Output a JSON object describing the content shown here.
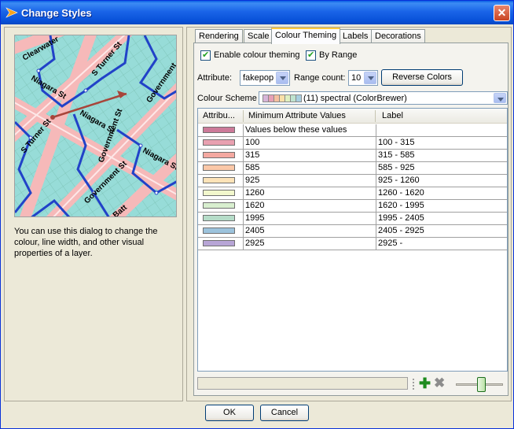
{
  "window": {
    "title": "Change Styles",
    "close_glyph": "✕"
  },
  "map_preview": {
    "streets": [
      "Clearwater",
      "Niagara St",
      "S Turner St",
      "Government",
      "Niagara St",
      "S Turner St",
      "Government St",
      "Niagara St",
      "Government St",
      "Batt"
    ]
  },
  "help_text": "You can use this dialog to change the colour, line width, and other visual properties of a layer.",
  "tabs": [
    {
      "label": "Rendering",
      "active": false
    },
    {
      "label": "Scale",
      "active": false
    },
    {
      "label": "Colour Theming",
      "active": true
    },
    {
      "label": "Labels",
      "active": false
    },
    {
      "label": "Decorations",
      "active": false
    }
  ],
  "theming": {
    "enable_label": "Enable colour theming",
    "enable_checked": true,
    "by_range_label": "By Range",
    "by_range_checked": true,
    "attribute_label": "Attribute:",
    "attribute_value": "fakepop",
    "range_count_label": "Range count:",
    "range_count_value": "10",
    "reverse_button": "Reverse Colors",
    "scheme_label": "Colour Scheme",
    "scheme_value": "(11) spectral (ColorBrewer)",
    "scheme_swatches": [
      "#d7b5d8",
      "#e7a0b5",
      "#f5c0a0",
      "#fae0a8",
      "#e0f0c0",
      "#bfe3cf",
      "#a8cfe0"
    ]
  },
  "table": {
    "headers": [
      "Attribu...",
      "Minimum Attribute Values",
      "Label"
    ],
    "rows": [
      {
        "color": "#cc7a99",
        "min": "Values below these values",
        "label": ""
      },
      {
        "color": "#e8a0b0",
        "min": "100",
        "label": "100 - 315"
      },
      {
        "color": "#f4a8a0",
        "min": "315",
        "label": "315 - 585"
      },
      {
        "color": "#fbc8a8",
        "min": "585",
        "label": "585 - 925"
      },
      {
        "color": "#fde3b8",
        "min": "925",
        "label": "925 - 1260"
      },
      {
        "color": "#f2f7cc",
        "min": "1260",
        "label": "1260 - 1620"
      },
      {
        "color": "#d8efcf",
        "min": "1620",
        "label": "1620 - 1995"
      },
      {
        "color": "#b5dcc8",
        "min": "1995",
        "label": "1995 - 2405"
      },
      {
        "color": "#9cc3dc",
        "min": "2405",
        "label": "2405 - 2925"
      },
      {
        "color": "#b7a5d6",
        "min": "2925",
        "label": "2925 -"
      }
    ]
  },
  "footer": {
    "ok_label": "OK",
    "cancel_label": "Cancel"
  }
}
